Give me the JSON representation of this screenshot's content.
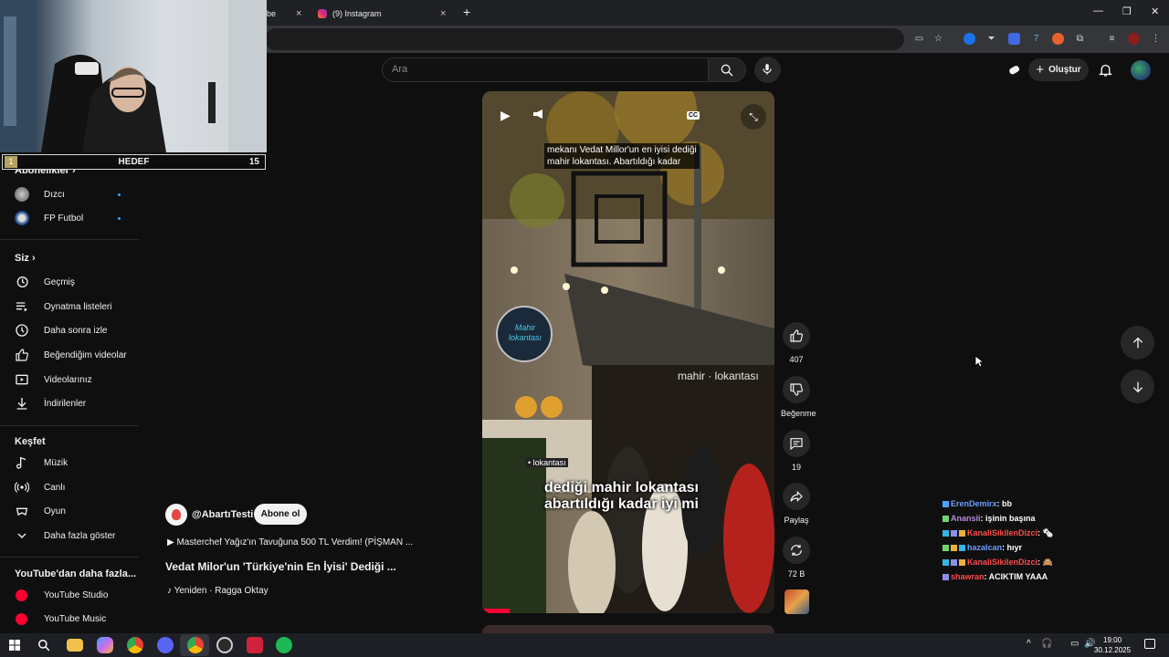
{
  "browser": {
    "tabs": [
      {
        "label": "be",
        "close": "×"
      },
      {
        "label": "(9) Instagram",
        "close": "×"
      }
    ],
    "new_tab": "+",
    "window_controls": {
      "minimize": "—",
      "restore": "❐",
      "close": "✕"
    }
  },
  "header": {
    "search_placeholder": "Ara",
    "create_label": "Oluştur"
  },
  "overlay": {
    "goal_number": "1",
    "goal_title": "HEDEF",
    "goal_count": "15"
  },
  "sidebar": {
    "subscriptions_heading": "Abonelikler",
    "subscriptions": [
      {
        "label": "Dızcı"
      },
      {
        "label": "FP Futbol"
      }
    ],
    "you_heading": "Siz",
    "you_items": [
      {
        "label": "Geçmiş",
        "icon": "history-icon"
      },
      {
        "label": "Oynatma listeleri",
        "icon": "playlist-icon"
      },
      {
        "label": "Daha sonra izle",
        "icon": "clock-icon"
      },
      {
        "label": "Beğendiğim videolar",
        "icon": "thumbs-up-icon"
      },
      {
        "label": "Videolarınız",
        "icon": "video-icon"
      },
      {
        "label": "İndirilenler",
        "icon": "download-icon"
      }
    ],
    "explore_heading": "Keşfet",
    "explore_items": [
      {
        "label": "Müzik",
        "icon": "music-icon"
      },
      {
        "label": "Canlı",
        "icon": "live-icon"
      },
      {
        "label": "Oyun",
        "icon": "gaming-icon"
      },
      {
        "label": "Daha fazla göster",
        "icon": "chevron-down-icon"
      }
    ],
    "more_heading": "YouTube'dan daha fazla...",
    "more_items": [
      {
        "label": "YouTube Studio"
      },
      {
        "label": "YouTube Music"
      }
    ]
  },
  "video": {
    "caption_top_line1": "mekanı Vedat Millor'un en iyisi dediği",
    "caption_top_line2": "mahir lokantası. Abartıldığı kadar",
    "caption_main_line1": "dediği mahir lokantası",
    "caption_main_line2": "abartıldığı kadar iyi mi",
    "sign_text": "Mahir lokantası",
    "storefront_text": "mahir · lokantası",
    "small_sign": "• lokantası",
    "cc_label": "CC"
  },
  "actions": {
    "like_count": "407",
    "dislike_label": "Beğenme",
    "comment_count": "19",
    "share_label": "Paylaş",
    "remix_count": "72 B"
  },
  "channel": {
    "handle": "@AbartıTesti",
    "subscribe_label": "Abone ol",
    "related": "▶  Masterchef Yağız'ın Tavuğuna 500 TL Verdim! (PİŞMAN ...",
    "title": "Vedat Milor'un 'Türkiye'nin En İyisi' Dediği ...",
    "music": "♪ Yeniden · Ragga Oktay"
  },
  "chat": [
    {
      "user": "ErenDemirx",
      "message": ": bb",
      "color": "#6c9cff"
    },
    {
      "user": "Anansii",
      "message": ": işinin başına",
      "color": "#b88ad8"
    },
    {
      "user": "KanaliSikilenDizci",
      "message": ": 🗞",
      "color": "#ff4b4b"
    },
    {
      "user": "hazalcan",
      "message": ": hıyr",
      "color": "#6c9cff"
    },
    {
      "user": "KanaliSikilenDizci",
      "message": ": 🙈",
      "color": "#ff4b4b"
    },
    {
      "user": "shawran",
      "message": ": ACIKTIM YAAA",
      "color": "#ff4b4b"
    }
  ],
  "taskbar": {
    "time": "19:00",
    "date": "30.12.2025"
  },
  "colors": {
    "background": "#0f0f0f",
    "accent_blue": "#3ea6ff",
    "youtube_red": "#ff0033",
    "goal_badge": "#b6a25c"
  }
}
